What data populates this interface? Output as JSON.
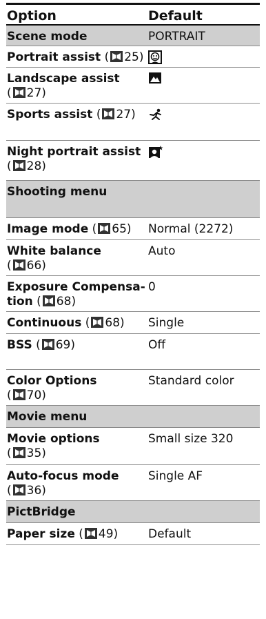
{
  "header": {
    "option": "Option",
    "default": "Default"
  },
  "rows": [
    {
      "type": "section",
      "option": "Scene mode",
      "default": "PORTRAIT"
    },
    {
      "type": "item",
      "name": "Portrait assist",
      "ref_open": " (",
      "page": "25",
      "ref_close": ")",
      "icon": "portrait-face-icon"
    },
    {
      "type": "item",
      "name": "Landscape assist",
      "ref_open": "(",
      "page": "27",
      "ref_close": ")",
      "icon": "landscape-mountain-icon"
    },
    {
      "type": "item",
      "name": "Sports assist",
      "ref_open": " (",
      "page": "27",
      "ref_close": ")",
      "icon": "sports-runner-icon"
    },
    {
      "type": "item",
      "name": "Night portrait assist",
      "ref_open": "(",
      "page": "28",
      "ref_close": ")",
      "icon": "night-portrait-star-icon"
    },
    {
      "type": "section",
      "option": "Shooting menu",
      "default": ""
    },
    {
      "type": "item",
      "name": "Image mode",
      "ref_open": " (",
      "page": "65",
      "ref_close": ")",
      "default": "Normal (2272)"
    },
    {
      "type": "item",
      "name": "White balance",
      "ref_open": "(",
      "page": "66",
      "ref_close": ")",
      "default": "Auto"
    },
    {
      "type": "item",
      "name": "Exposure Compensa-",
      "name2": "tion",
      "ref_open": " (",
      "page": "68",
      "ref_close": ")",
      "default": "0"
    },
    {
      "type": "item",
      "name": "Continuous",
      "ref_open": " (",
      "page": "68",
      "ref_close": ")",
      "default": "Single"
    },
    {
      "type": "item",
      "name": "BSS",
      "ref_open": " (",
      "page": "69",
      "ref_close": ")",
      "default": "Off"
    },
    {
      "type": "item",
      "name": "Color Options",
      "ref_open": "(",
      "page": "70",
      "ref_close": ")",
      "default": "Standard color"
    },
    {
      "type": "section",
      "option": "Movie menu",
      "default": ""
    },
    {
      "type": "item",
      "name": "Movie options",
      "ref_open": "(",
      "page": "35",
      "ref_close": ")",
      "default": "Small size 320"
    },
    {
      "type": "item",
      "name": "Auto-focus mode",
      "ref_open": "(",
      "page": "36",
      "ref_close": ")",
      "default": "Single AF"
    },
    {
      "type": "section",
      "option": "PictBridge",
      "default": ""
    },
    {
      "type": "item",
      "name": "Paper size",
      "ref_open": " (",
      "page": "49",
      "ref_close": ")",
      "default": "Default"
    }
  ]
}
